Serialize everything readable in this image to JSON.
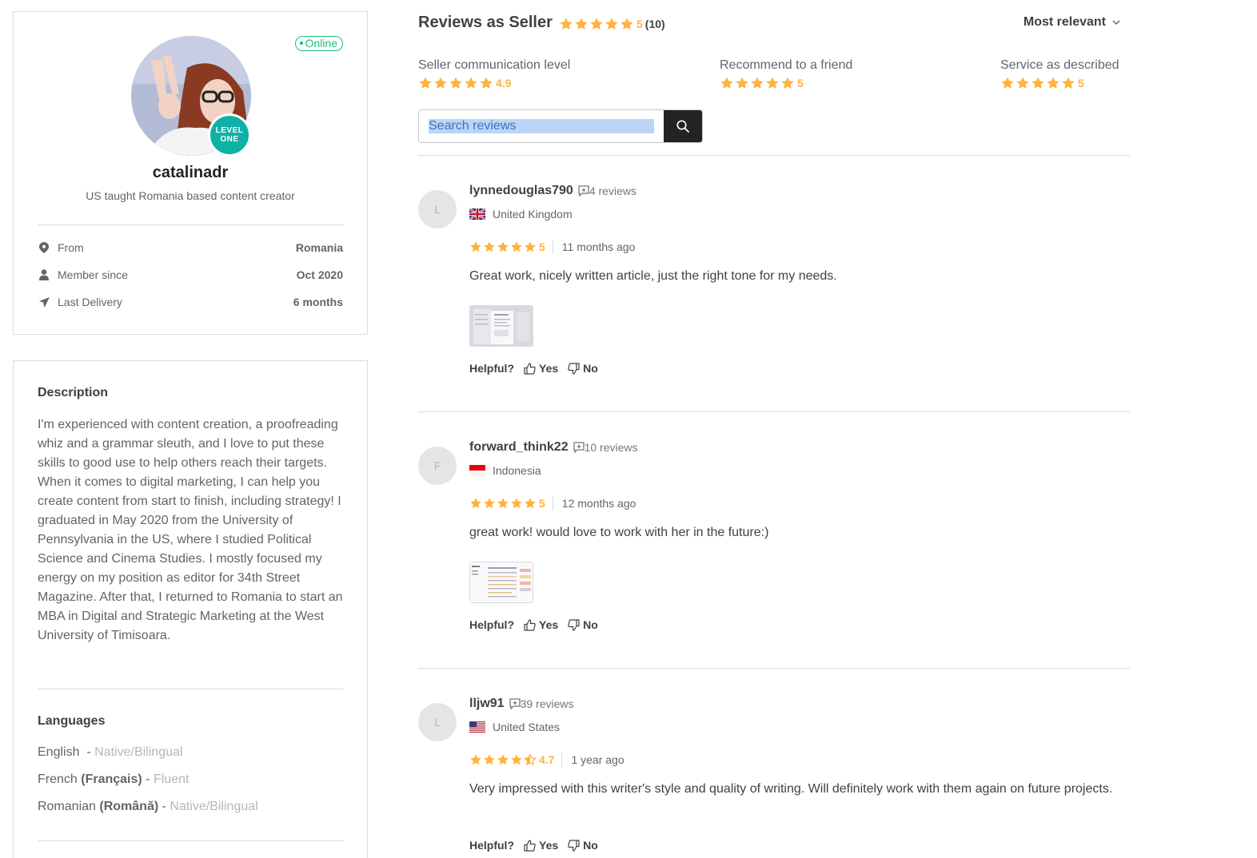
{
  "profile": {
    "status": "Online",
    "level_line1": "LEVEL",
    "level_line2": "ONE",
    "username": "catalinadr",
    "tagline": "US taught Romania based content creator",
    "stats": [
      {
        "label": "From",
        "value": "Romania",
        "icon": "location-pin-icon"
      },
      {
        "label": "Member since",
        "value": "Oct 2020",
        "icon": "user-icon"
      },
      {
        "label": "Last Delivery",
        "value": "6 months",
        "icon": "send-icon"
      }
    ]
  },
  "description": {
    "title": "Description",
    "text": "I'm experienced with content creation, a proofreading whiz and a grammar sleuth, and I love to put these skills to good use to help others reach their targets. When it comes to digital marketing, I can help you create content from start to finish, including strategy! I graduated in May 2020 from the University of Pennsylvania in the US, where I studied Political Science and Cinema Studies. I mostly focused my energy on my position as editor for 34th Street Magazine. After that, I returned to Romania to start an MBA in Digital and Strategic Marketing at the West University of Timisoara."
  },
  "languages": {
    "title": "Languages",
    "items": [
      {
        "name": "English",
        "native": "",
        "level": "Native/Bilingual"
      },
      {
        "name": "French",
        "native": "(Français)",
        "level": "Fluent"
      },
      {
        "name": "Romanian",
        "native": "(Română)",
        "level": "Native/Bilingual"
      }
    ]
  },
  "reviews_header": {
    "title": "Reviews as Seller",
    "rating": "5",
    "count": "(10)",
    "sort_label": "Most relevant"
  },
  "sub_ratings": [
    {
      "label": "Seller communication level",
      "value": "4.9",
      "stars": 5
    },
    {
      "label": "Recommend to a friend",
      "value": "5",
      "stars": 5
    },
    {
      "label": "Service as described",
      "value": "5",
      "stars": 5
    }
  ],
  "search": {
    "placeholder": "Search reviews"
  },
  "colors": {
    "star": "#ffb33e",
    "online": "#1dbf73",
    "level_badge": "#0fb1a7",
    "search_button": "#222325"
  },
  "reviews": [
    {
      "initial": "L",
      "name": "lynnedouglas790",
      "review_count": "4 reviews",
      "country": "United Kingdom",
      "flag": "uk-flag-icon",
      "rating": "5",
      "stars": 5,
      "time": "11 months ago",
      "text": "Great work, nicely written article, just the right tone for my needs.",
      "helpful_label": "Helpful?",
      "yes": "Yes",
      "no": "No"
    },
    {
      "initial": "F",
      "name": "forward_think22",
      "review_count": "10 reviews",
      "country": "Indonesia",
      "flag": "indonesia-flag-icon",
      "rating": "5",
      "stars": 5,
      "time": "12 months ago",
      "text": "great work! would love to work with her in the future:)",
      "helpful_label": "Helpful?",
      "yes": "Yes",
      "no": "No"
    },
    {
      "initial": "L",
      "name": "lljw91",
      "review_count": "39 reviews",
      "country": "United States",
      "flag": "us-flag-icon",
      "rating": "4.7",
      "stars": 4.5,
      "time": "1 year ago",
      "text": "Very impressed with this writer's style and quality of writing. Will definitely work with them again on future projects.",
      "helpful_label": "Helpful?",
      "yes": "Yes",
      "no": "No"
    }
  ]
}
